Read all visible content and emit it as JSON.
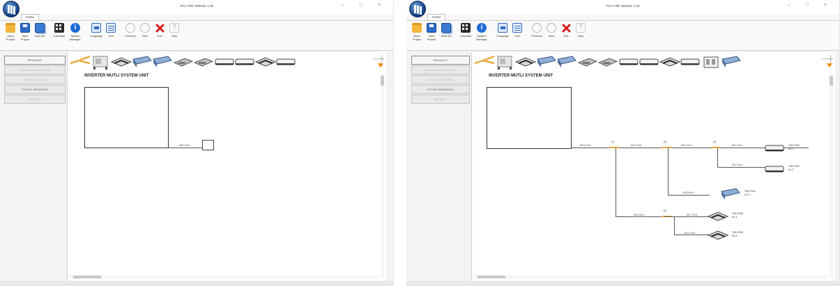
{
  "app": {
    "title": "TICA VRF Selector 1.20",
    "window_controls": "– □ ×"
  },
  "ribbon": {
    "tab_home": "Home",
    "buttons": [
      {
        "icon": "folder-icon",
        "label": "Open Project"
      },
      {
        "icon": "save-icon",
        "label": "Save Project"
      },
      {
        "icon": "save-as-icon",
        "label": "Save As"
      },
      {
        "icon": "calculate-icon",
        "label": "Calculate"
      },
      {
        "icon": "info-icon",
        "label": "System Manager"
      },
      {
        "icon": "language-icon",
        "label": "Language"
      },
      {
        "icon": "unit-icon",
        "label": "Unit"
      },
      {
        "icon": "previous-icon",
        "label": "Previous"
      },
      {
        "icon": "next-icon",
        "label": "Next"
      },
      {
        "icon": "exit-icon",
        "label": "Exit"
      },
      {
        "icon": "help-icon",
        "label": "Help"
      }
    ]
  },
  "nav": [
    {
      "label": "PROJECT",
      "state": "active"
    },
    {
      "label": "LOAD CALCULATION",
      "state": "dim"
    },
    {
      "label": "AC SELECTION",
      "state": "dim"
    },
    {
      "label": "PIPING DRAWING",
      "state": "normal"
    },
    {
      "label": "REPORT",
      "state": "dim"
    }
  ],
  "canvas": {
    "system_title": "INVERTER MUTLI SYSTEM UNIT"
  },
  "colors": {
    "branch_joint": "#e7a93f",
    "exit_red": "#d81e1e",
    "dropdown_arrow": "#f08a00"
  },
  "unit_palette": {
    "left": [
      "refnet-joint-icon",
      "outdoor-unit-icon",
      "cassette-unit-icon",
      "duct-unit-icon",
      "duct-unit-icon",
      "ceiling-unit-icon",
      "ceiling-unit-icon",
      "wall-unit-icon",
      "wall-unit-icon",
      "cassette-unit-icon",
      "wall-unit-icon"
    ],
    "right": [
      "refnet-joint-icon",
      "outdoor-unit-icon",
      "cassette-unit-icon",
      "duct-unit-icon",
      "duct-unit-icon",
      "ceiling-unit-icon",
      "ceiling-unit-icon",
      "wall-unit-icon",
      "wall-unit-icon",
      "cassette-unit-icon",
      "wall-unit-icon",
      "console-unit-icon",
      "duct-unit-icon"
    ]
  },
  "diagram_left": {
    "pipe_label": "Ø22.0/9.5"
  },
  "diagram_right": {
    "pipe_labels": [
      "Ø19.1/9.5",
      "Ø22.0/9.5",
      "Ø12.7/6.4",
      "Ø12.7/6.4",
      "Ø12.7/6.4",
      "Ø15.9/6.4",
      "Ø15.9/6.4",
      "Ø12.7/6.4",
      "Ø12.7/6.4"
    ],
    "branch_numbers": [
      "(1)",
      "(2)",
      "(4)",
      "(3)"
    ],
    "units": [
      {
        "model": "TMCF036",
        "id": "A1-1"
      },
      {
        "model": "TMCF036",
        "id": "A1-2"
      },
      {
        "model": "TMCF036",
        "id": "A1-3"
      },
      {
        "model": "TMCC036",
        "id": "B1-4"
      },
      {
        "model": "TMCC036",
        "id": "B1-5"
      }
    ]
  }
}
